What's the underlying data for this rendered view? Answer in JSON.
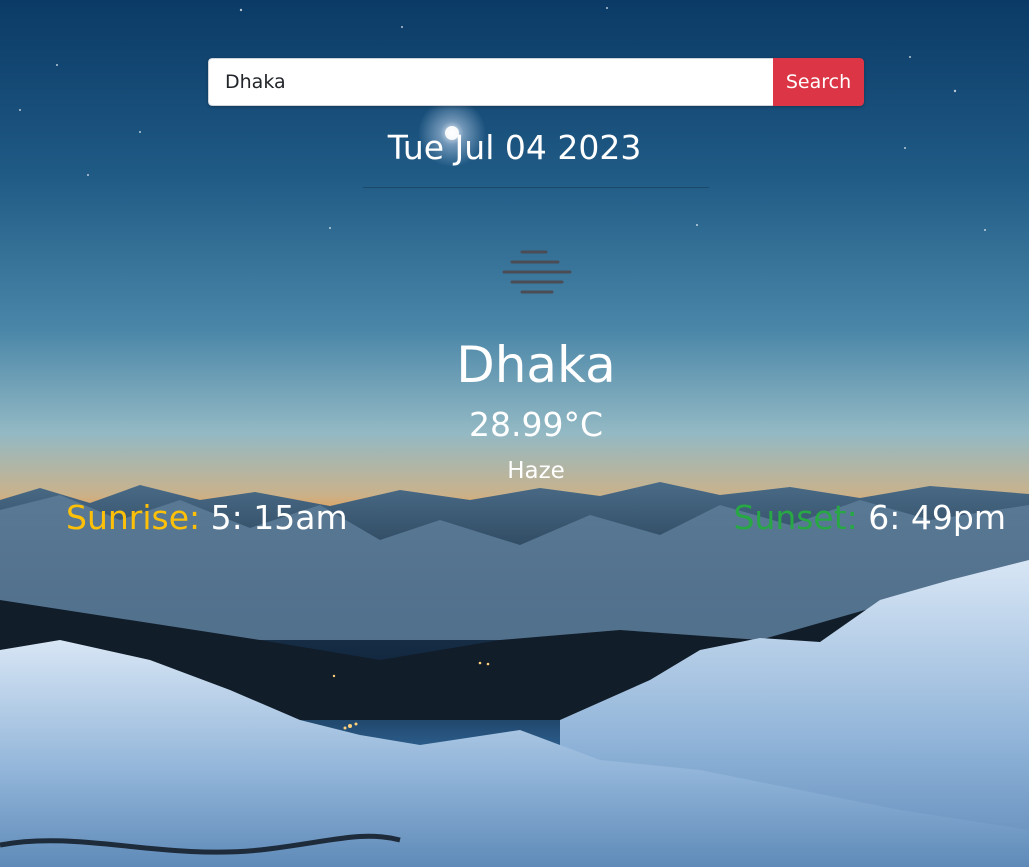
{
  "search": {
    "value": "Dhaka",
    "button_label": "Search"
  },
  "date": "Tue Jul 04 2023",
  "weather": {
    "icon": "haze-icon",
    "city": "Dhaka",
    "temperature": "28.99°C",
    "condition": "Haze"
  },
  "sun": {
    "sunrise_label": "Sunrise:",
    "sunrise_time": "5: 15am",
    "sunset_label": "Sunset:",
    "sunset_time": "6: 49pm"
  },
  "colors": {
    "search_button": "#dc3545",
    "sunrise_label": "#ffc107",
    "sunset_label": "#28a745",
    "text": "#ffffff"
  }
}
